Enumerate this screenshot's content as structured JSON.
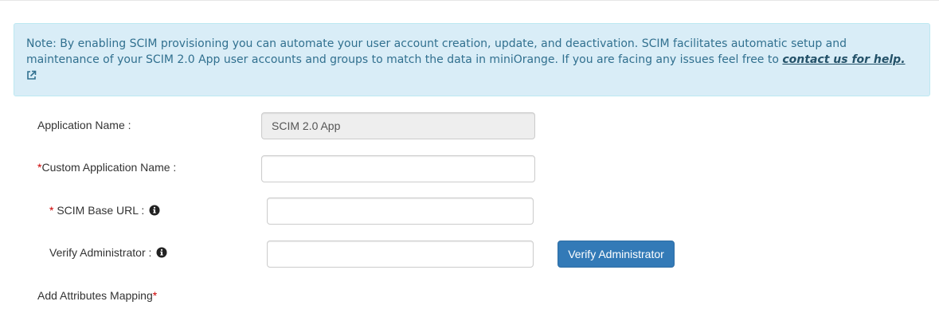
{
  "note": {
    "text": "Note: By enabling SCIM provisioning you can automate your user account creation, update, and deactivation. SCIM facilitates automatic setup and maintenance of your SCIM 2.0 App user accounts and groups to match the data in miniOrange. If you are facing any issues feel free to ",
    "link_text": "contact us for help.",
    "link_icon": "external-link-icon"
  },
  "form": {
    "application_name": {
      "label": "Application Name :",
      "value": "SCIM 2.0 App"
    },
    "custom_application_name": {
      "required_mark": "*",
      "label": "Custom Application Name :",
      "value": ""
    },
    "scim_base_url": {
      "required_mark": "*",
      "label": " SCIM Base URL :",
      "value": "",
      "icon": "info-circle-icon"
    },
    "verify_administrator": {
      "label": "Verify Administrator :",
      "value": "",
      "icon": "info-circle-icon",
      "button_label": "Verify Administrator"
    },
    "add_attributes_mapping": {
      "label": "Add Attributes Mapping",
      "required_mark": "*"
    }
  },
  "colors": {
    "note_bg": "#d9edf7",
    "note_text": "#31708f",
    "button_bg": "#337ab7",
    "required": "#cc0000"
  }
}
